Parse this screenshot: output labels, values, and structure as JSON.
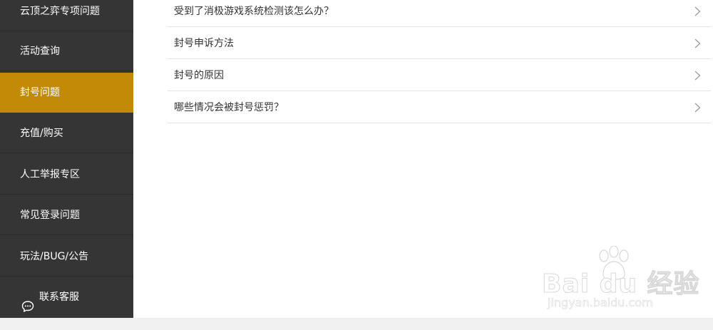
{
  "sidebar": {
    "items": [
      {
        "label": "云顶之弈专项问题",
        "active": false
      },
      {
        "label": "活动查询",
        "active": false
      },
      {
        "label": "封号问题",
        "active": true
      },
      {
        "label": "充值/购买",
        "active": false
      },
      {
        "label": "人工举报专区",
        "active": false
      },
      {
        "label": "常见登录问题",
        "active": false
      },
      {
        "label": "玩法/BUG/公告",
        "active": false
      }
    ],
    "contact": {
      "label": "联系客服",
      "icon": "chat-bubble-icon"
    },
    "active_color": "#c28a07",
    "bg_color": "#353535"
  },
  "faq": {
    "items": [
      {
        "title": "受到了消极游戏系统检测该怎么办？",
        "icon": "chevron-right-icon"
      },
      {
        "title": "封号申诉方法",
        "icon": "chevron-right-icon"
      },
      {
        "title": "封号的原因",
        "icon": "chevron-right-icon"
      },
      {
        "title": "哪些情况会被封号惩罚？",
        "icon": "chevron-right-icon"
      }
    ]
  },
  "watermark": {
    "brand": "Bai du 经验",
    "url": "jingyan.baidu.com"
  }
}
